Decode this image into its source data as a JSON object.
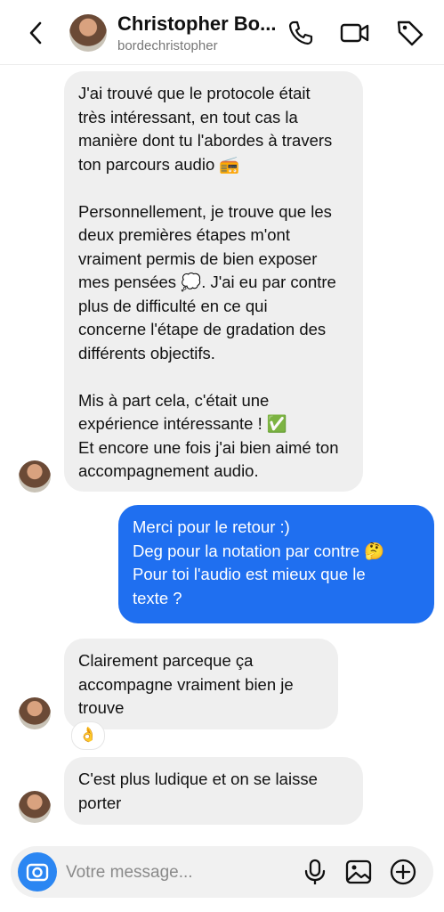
{
  "header": {
    "name": "Christopher Bo...",
    "username": "bordechristopher"
  },
  "messages": {
    "m1": "J'ai trouvé que le protocole était\ntrès intéressant, en tout cas la\nmanière dont tu l'abordes à travers\nton parcours audio 📻\n\nPersonnellement, je trouve que les\ndeux premières étapes m'ont\nvraiment permis de bien exposer\nmes pensées 💭. J'ai eu par contre\nplus de difficulté en ce qui\nconcerne l'étape de gradation des\ndifférents objectifs.\n\nMis à part cela, c'était une\nexpérience intéressante ! ✅\nEt encore une fois j'ai bien aimé ton\naccompagnement audio.",
    "m2": "Merci pour le retour :)\nDeg pour la notation par contre 🤔\nPour toi l'audio est mieux que le\ntexte ?",
    "m3": "Clairement parceque ça\naccompagne vraiment bien je\ntrouve",
    "m3_reaction": "👌",
    "m4": "C'est plus ludique et on se laisse\nporter"
  },
  "composer": {
    "placeholder": "Votre message..."
  }
}
